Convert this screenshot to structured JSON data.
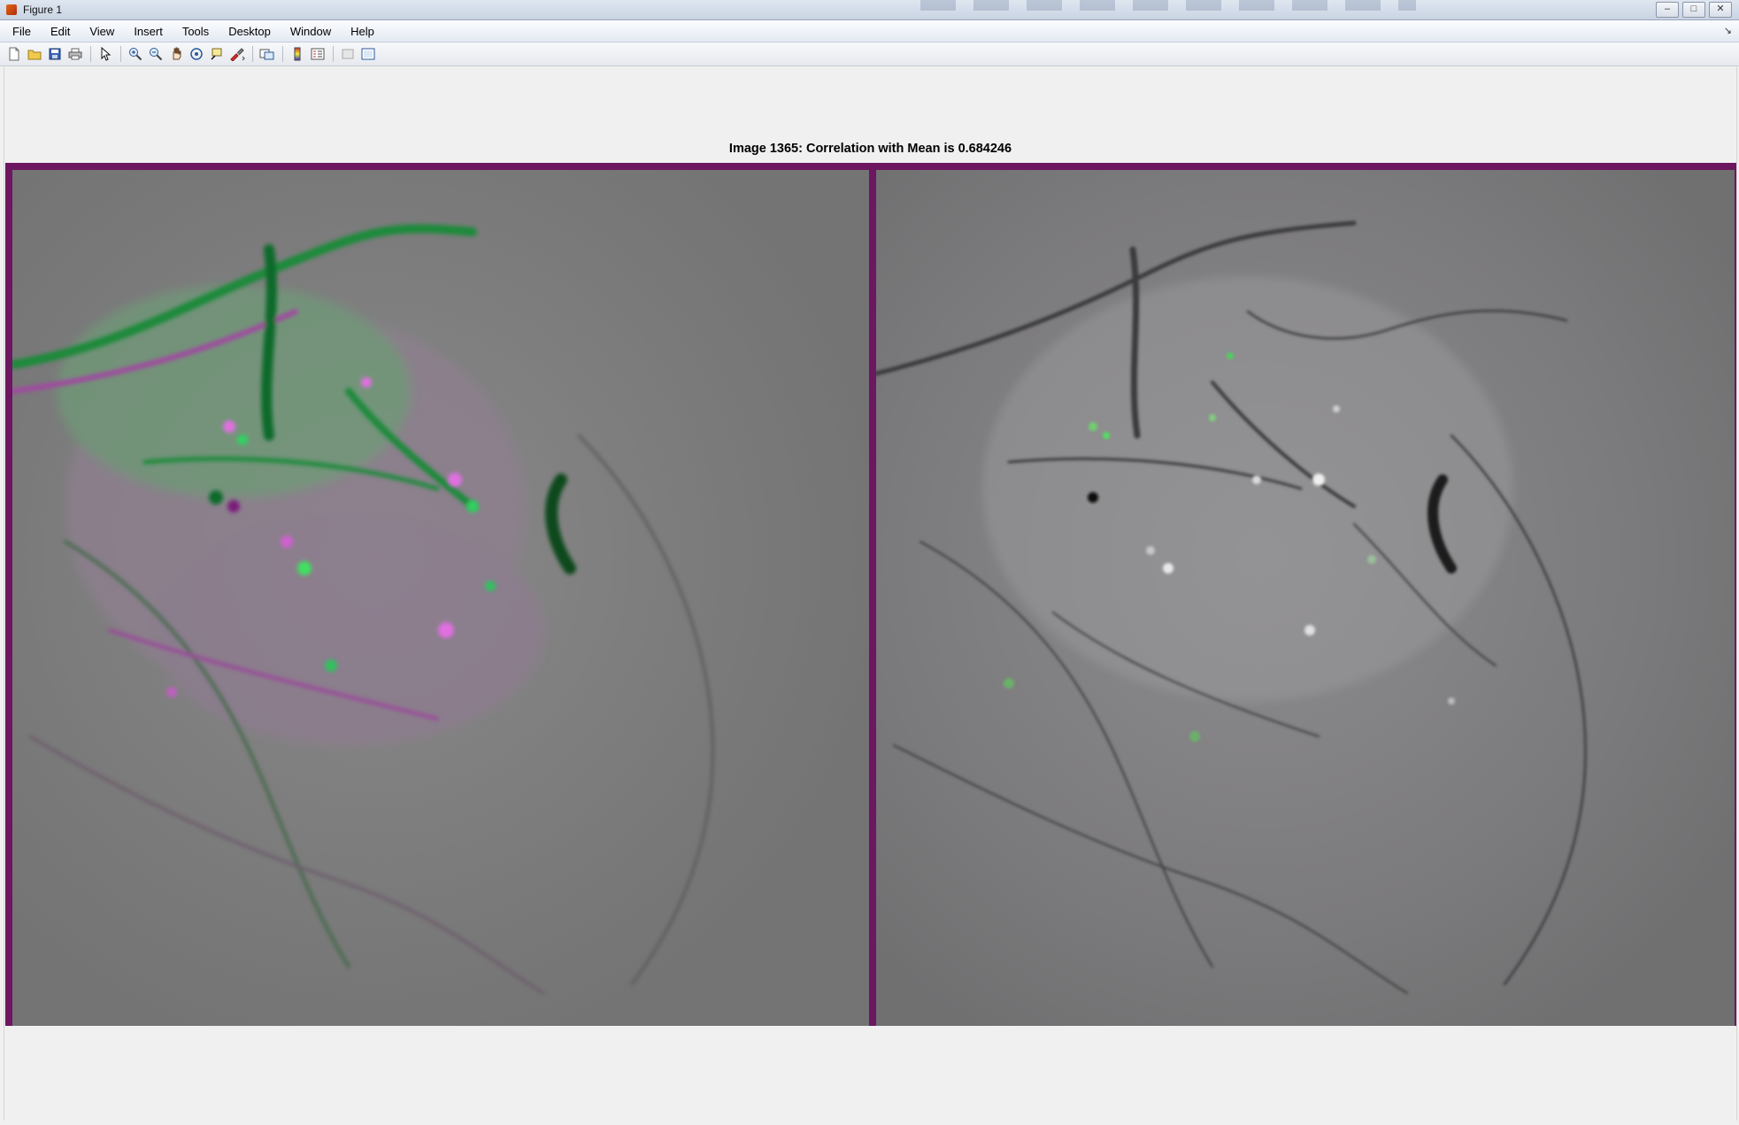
{
  "window": {
    "title": "Figure 1",
    "controls": [
      "minimize",
      "maximize",
      "close"
    ]
  },
  "menubar": {
    "items": [
      "File",
      "Edit",
      "View",
      "Insert",
      "Tools",
      "Desktop",
      "Window",
      "Help"
    ]
  },
  "toolbar": {
    "icons": [
      "new-figure-icon",
      "open-file-icon",
      "save-icon",
      "print-icon",
      "edit-plot-icon",
      "zoom-in-icon",
      "zoom-out-icon",
      "pan-icon",
      "rotate-3d-icon",
      "data-cursor-icon",
      "brush-icon",
      "link-plot-icon",
      "colorbar-icon",
      "legend-icon",
      "hide-plot-tools-icon",
      "show-plot-tools-icon"
    ]
  },
  "figure": {
    "title": "Image 1365: Correlation with Mean is 0.684246",
    "colors": {
      "frame": "#6d1760",
      "overlay_a": "#00b040",
      "overlay_b": "#c040c0",
      "background_gray": "#777777"
    }
  }
}
